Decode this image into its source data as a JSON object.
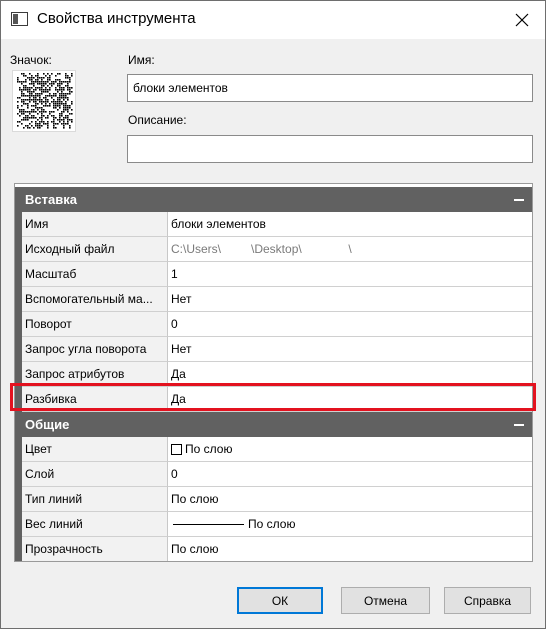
{
  "window": {
    "title": "Свойства инструмента"
  },
  "left": {
    "icon_label": "Значок:"
  },
  "fields": {
    "name_label": "Имя:",
    "name_value": "блоки элементов",
    "desc_label": "Описание:",
    "desc_value": ""
  },
  "grid": {
    "insert": {
      "title": "Вставка",
      "rows": [
        {
          "key": "Имя",
          "value": "блоки элементов"
        },
        {
          "key": "Исходный файл",
          "value": "C:\\Users\\         \\Desktop\\              \\"
        },
        {
          "key": "Масштаб",
          "value": "1"
        },
        {
          "key": "Вспомогательный ма...",
          "value": "Нет"
        },
        {
          "key": "Поворот",
          "value": "0"
        },
        {
          "key": "Запрос угла поворота",
          "value": "Нет"
        },
        {
          "key": "Запрос атрибутов",
          "value": "Да"
        },
        {
          "key": "Разбивка",
          "value": "Да"
        }
      ]
    },
    "general": {
      "title": "Общие",
      "rows": [
        {
          "key": "Цвет",
          "value": "По слою"
        },
        {
          "key": "Слой",
          "value": "0"
        },
        {
          "key": "Тип линий",
          "value": "По слою"
        },
        {
          "key": "Вес линий",
          "value": "По слою"
        },
        {
          "key": "Прозрачность",
          "value": "По слою"
        }
      ]
    }
  },
  "buttons": {
    "ok": "ОК",
    "cancel": "Отмена",
    "help": "Справка"
  },
  "colors": {
    "category_bg": "#616161",
    "highlight": "#e3121f",
    "focus": "#0078d7"
  }
}
